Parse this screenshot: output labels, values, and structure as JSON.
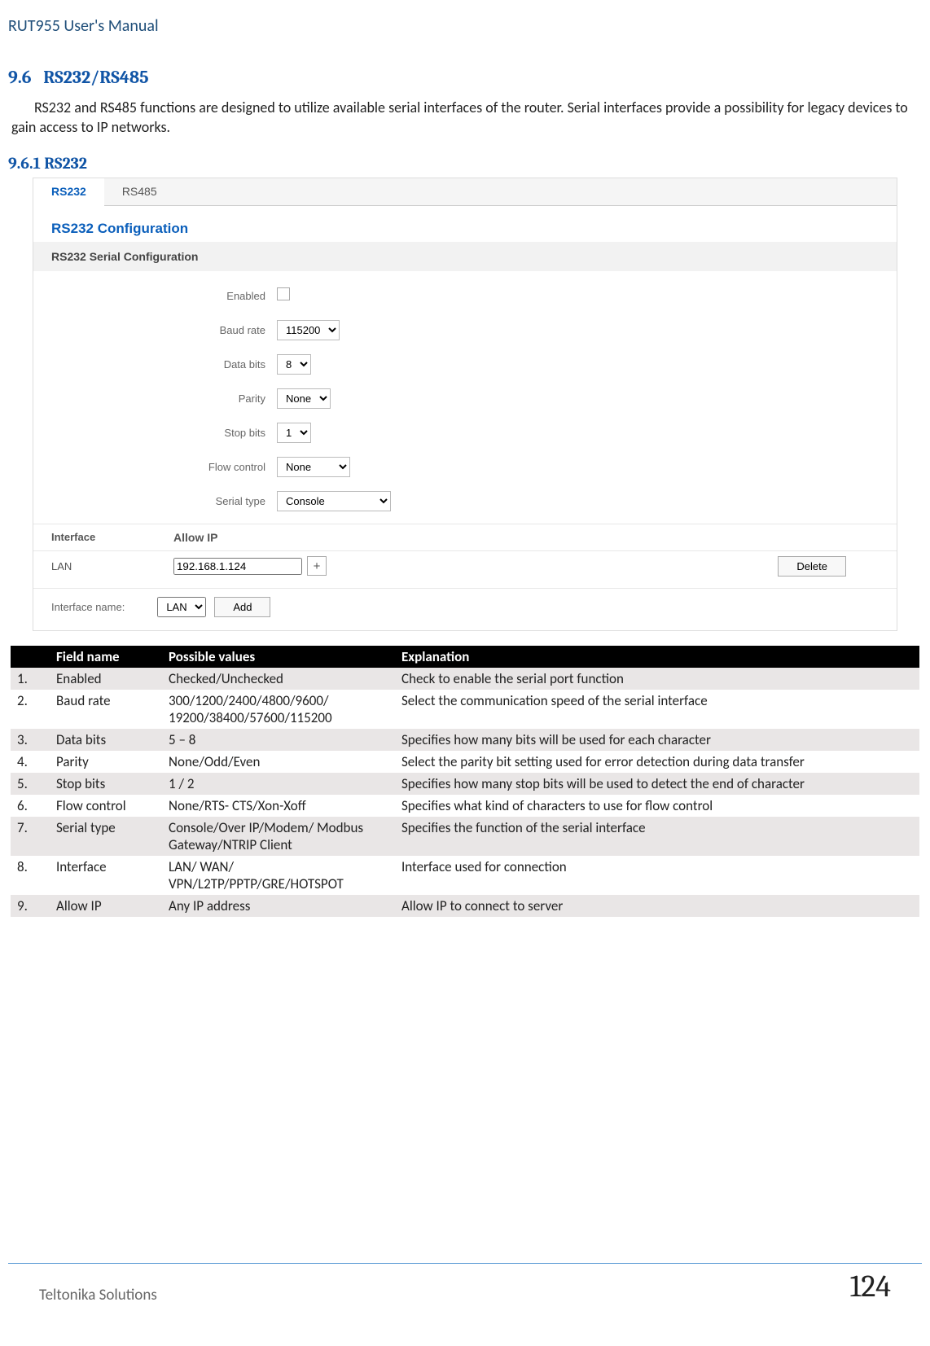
{
  "header": {
    "title": "RUT955 User's Manual"
  },
  "section": {
    "num": "9.6",
    "title": "RS232/RS485",
    "intro": "RS232 and RS485 functions are designed to utilize available serial interfaces of the router. Serial interfaces provide a possibility for legacy devices to gain access to IP networks.",
    "sub_num": "9.6.1",
    "sub_title": "RS232"
  },
  "shot": {
    "tabs": {
      "active": "RS232",
      "other": "RS485"
    },
    "conf_heading": "RS232 Configuration",
    "sub_heading": "RS232 Serial Configuration",
    "fields": {
      "enabled_label": "Enabled",
      "baud_label": "Baud rate",
      "baud_value": "115200",
      "databits_label": "Data bits",
      "databits_value": "8",
      "parity_label": "Parity",
      "parity_value": "None",
      "stopbits_label": "Stop bits",
      "stopbits_value": "1",
      "flow_label": "Flow control",
      "flow_value": "None",
      "serialtype_label": "Serial type",
      "serialtype_value": "Console"
    },
    "iface_table": {
      "h1": "Interface",
      "h2": "Allow IP",
      "row_iface": "LAN",
      "row_ip": "192.168.1.124",
      "delete_btn": "Delete",
      "plus": "+",
      "add_label": "Interface name:",
      "add_value": "LAN",
      "add_btn": "Add"
    }
  },
  "table": {
    "headers": {
      "num": "",
      "field": "Field name",
      "possible": "Possible values",
      "explain": "Explanation"
    },
    "rows": [
      {
        "n": "1.",
        "f": "Enabled",
        "p": "Checked/Unchecked",
        "e": "Check to enable the serial port function"
      },
      {
        "n": "2.",
        "f": "Baud rate",
        "p": "300/1200/2400/4800/9600/ 19200/38400/57600/115200",
        "e": "Select the communication speed of the serial interface"
      },
      {
        "n": "3.",
        "f": "Data bits",
        "p": "5 – 8",
        "e": "Specifies how many bits will be used for each character"
      },
      {
        "n": "4.",
        "f": "Parity",
        "p": "None/Odd/Even",
        "e": "Select the parity bit setting used for error detection during data transfer"
      },
      {
        "n": "5.",
        "f": "Stop bits",
        "p": "1 / 2",
        "e": "Specifies how many stop bits will be used to detect the end of character"
      },
      {
        "n": "6.",
        "f": "Flow control",
        "p": "None/RTS- CTS/Xon-Xoff",
        "e": "Specifies what kind of characters to use for flow control"
      },
      {
        "n": "7.",
        "f": "Serial type",
        "p": "Console/Over IP/Modem/ Modbus Gateway/NTRIP Client",
        "e": "Specifies the function of the serial interface"
      },
      {
        "n": "8.",
        "f": "Interface",
        "p": "LAN/ WAN/ VPN/L2TP/PPTP/GRE/HOTSPOT",
        "e": "Interface used for connection"
      },
      {
        "n": "9.",
        "f": "Allow IP",
        "p": "Any IP address",
        "e": "Allow IP to connect to server"
      }
    ]
  },
  "footer": {
    "left": "Teltonika Solutions",
    "right": "124"
  }
}
